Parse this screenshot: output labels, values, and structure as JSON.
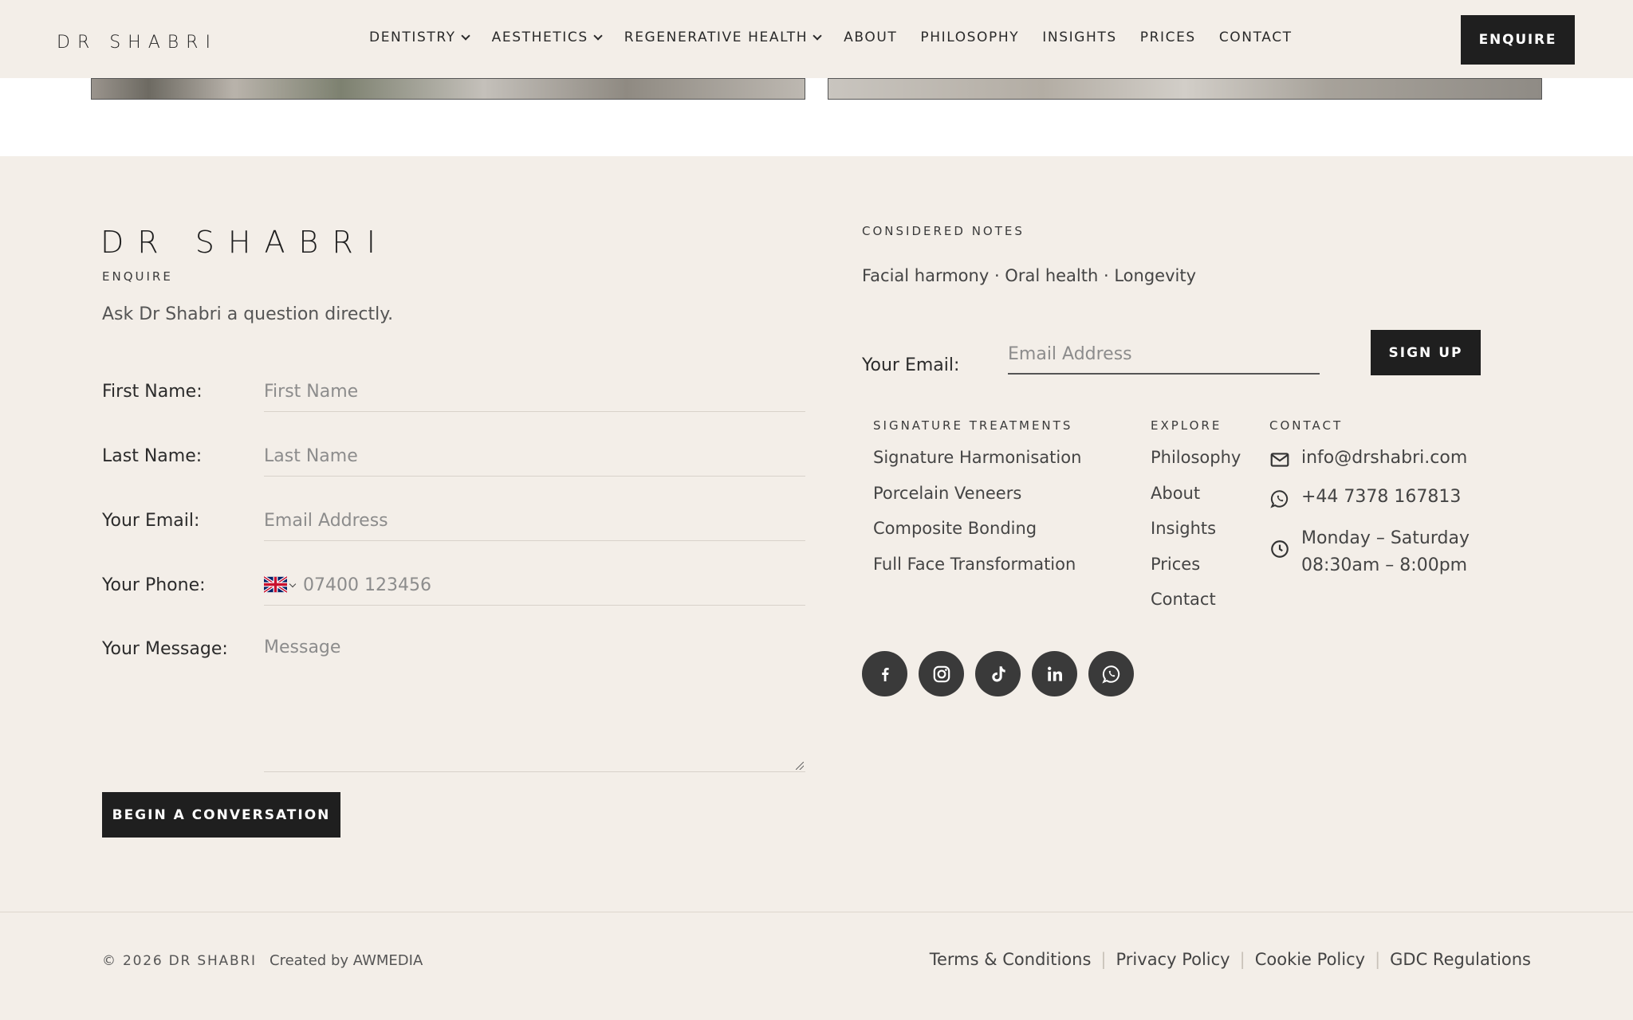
{
  "header": {
    "logo": "DR SHABRI",
    "nav": [
      "DENTISTRY",
      "AESTHETICS",
      "REGENERATIVE HEALTH",
      "ABOUT",
      "PHILOSOPHY",
      "INSIGHTS",
      "PRICES",
      "CONTACT"
    ],
    "enquire_label": "ENQUIRE"
  },
  "enquiry": {
    "logo": "DR SHABRI",
    "eyebrow": "ENQUIRE",
    "intro": "Ask Dr Shabri a question directly.",
    "fields": {
      "first_name": {
        "label": "First Name:",
        "placeholder": "First Name"
      },
      "last_name": {
        "label": "Last Name:",
        "placeholder": "Last Name"
      },
      "email": {
        "label": "Your Email:",
        "placeholder": "Email Address"
      },
      "phone": {
        "label": "Your Phone:",
        "placeholder": "07400 123456"
      },
      "message": {
        "label": "Your Message:",
        "placeholder": "Message"
      }
    },
    "submit_label": "BEGIN A CONVERSATION"
  },
  "newsletter": {
    "eyebrow": "CONSIDERED NOTES",
    "tagline": "Facial harmony · Oral health · Longevity",
    "email_label": "Your Email:",
    "email_placeholder": "Email Address",
    "signup_label": "SIGN UP"
  },
  "columns": {
    "treatments": {
      "heading": "SIGNATURE TREATMENTS",
      "items": [
        "Signature Harmonisation",
        "Porcelain Veneers",
        "Composite Bonding",
        "Full Face Transformation"
      ]
    },
    "explore": {
      "heading": "EXPLORE",
      "items": [
        "Philosophy",
        "About",
        "Insights",
        "Prices",
        "Contact"
      ]
    },
    "contact": {
      "heading": "CONTACT",
      "email": "info@drshabri.com",
      "phone": "+44 7378 167813",
      "hours_days": "Monday – Saturday",
      "hours_time": "08:30am – 8:00pm"
    }
  },
  "socials": [
    "facebook-icon",
    "instagram-icon",
    "tiktok-icon",
    "linkedin-icon",
    "whatsapp-icon"
  ],
  "bottom": {
    "copyright": "© 2026 DR SHABRI",
    "created_by": "Created by AWMEDIA",
    "legal": [
      "Terms & Conditions",
      "Privacy Policy",
      "Cookie Policy",
      "GDC Regulations"
    ]
  },
  "colors": {
    "background": "#f3eee8",
    "button": "#1f1f1f",
    "social": "#3a3a3a"
  }
}
